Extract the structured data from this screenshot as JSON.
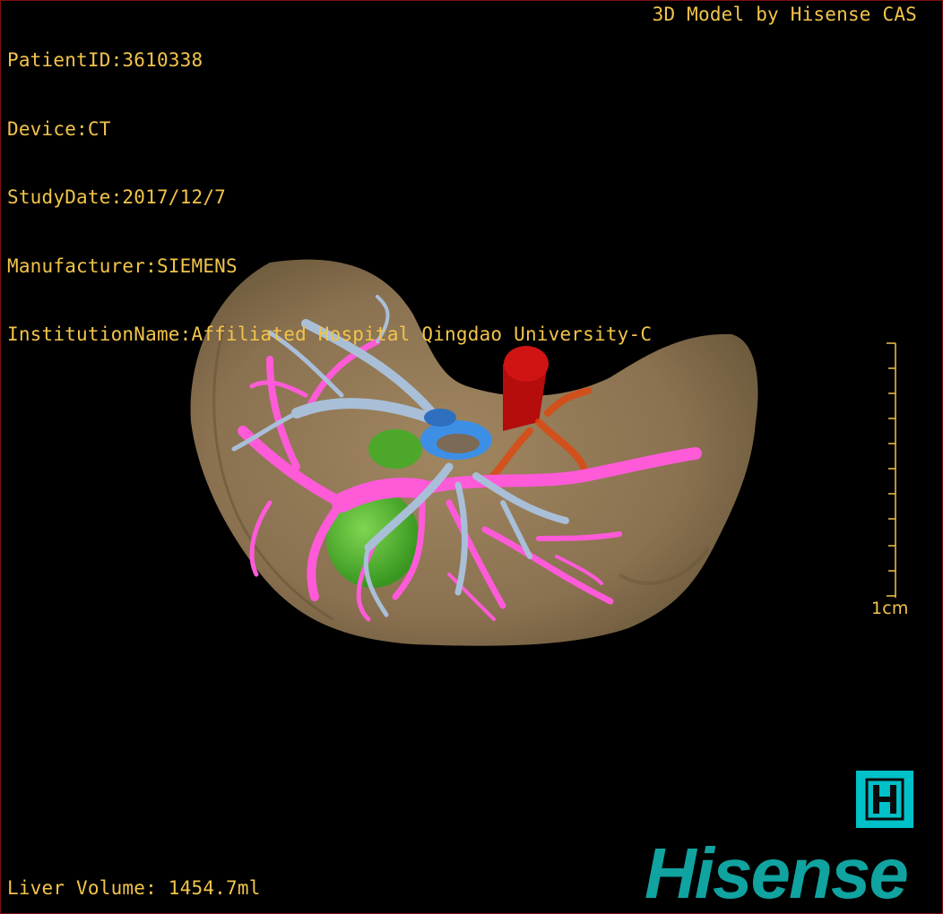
{
  "patient_info": {
    "patient_id": "PatientID:3610338",
    "device": "Device:CT",
    "study_date": "StudyDate:2017/12/7",
    "manufacturer": "Manufacturer:SIEMENS",
    "institution": "InstitutionName:Affiliated Hospital Qingdao University-C"
  },
  "credit": "3D Model by Hisense CAS",
  "liver_volume": "Liver Volume: 1454.7ml",
  "scale_bar": {
    "label": "1cm"
  },
  "branding": {
    "badge_letter": "H",
    "wordmark": "Hisense",
    "teal": "#10a3a0",
    "badge_color": "#00c0c8"
  },
  "colors": {
    "text": "#f2c44a",
    "liver": "#8c7450",
    "portal_vein": "#ff5ad8",
    "hepatic_vein": "#a9bfd8",
    "gallbladder": "#4cc82a",
    "artery": "#cc1010",
    "ivc": "#3d8fe6"
  },
  "icons": [
    "h-logo-icon",
    "scale-bar-icon"
  ]
}
